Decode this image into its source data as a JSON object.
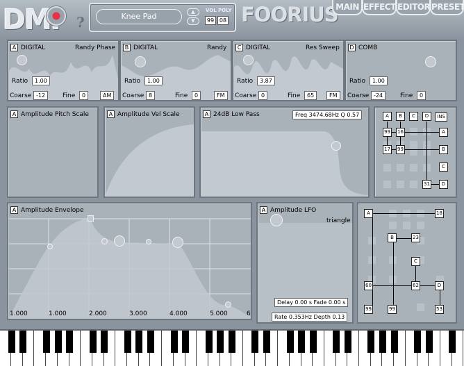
{
  "header": {
    "logo": "DMI",
    "help": "?",
    "brand": "FOORIUS",
    "patch_name": "Knee Pad",
    "vol_label": "VOL",
    "poly_label": "POLY",
    "vol": "99",
    "poly": "08",
    "arrow_up": "▲",
    "arrow_down": "▼",
    "tabs": [
      {
        "label": "MAIN"
      },
      {
        "label": "EFFECTS"
      },
      {
        "label": "EDITORS"
      },
      {
        "label": "PRESET"
      }
    ]
  },
  "osc": [
    {
      "letter": "A",
      "type": "DIGITAL",
      "wave": "Randy Phase",
      "ratio": "1.00",
      "coarse": "-12",
      "fine": "0",
      "mod": "AM"
    },
    {
      "letter": "B",
      "type": "DIGITAL",
      "wave": "Randy",
      "ratio": "1.00",
      "coarse": "8",
      "fine": "0",
      "mod": "FM"
    },
    {
      "letter": "C",
      "type": "DIGITAL",
      "wave": "Res Sweep",
      "ratio": "3.87",
      "coarse": "0",
      "fine": "65",
      "mod": "FM"
    },
    {
      "letter": "D",
      "type": "COMB",
      "wave": "",
      "ratio": "1.00",
      "coarse": "-24",
      "fine": "0",
      "mod": ""
    }
  ],
  "labels": {
    "ratio": "Ratio",
    "coarse": "Coarse",
    "fine": "Fine"
  },
  "mods": [
    {
      "letter": "A",
      "title": "Amplitude Pitch Scale"
    },
    {
      "letter": "A",
      "title": "Amplitude Vel Scale"
    },
    {
      "letter": "A",
      "title": "24dB Low Pass",
      "info": "Freq 3474.68Hz Q 0.57"
    }
  ],
  "matrix1": {
    "cols": [
      "A",
      "B",
      "C",
      "D"
    ],
    "ins": "INS",
    "rows": [
      "A",
      "B",
      "C",
      "D"
    ],
    "vals": {
      "r0c0": "99",
      "r0c1": "16",
      "r1c0": "17",
      "r1c1": "99",
      "r3c3": "31"
    }
  },
  "envelope": {
    "letter": "A",
    "title": "Amplitude Envelope",
    "ticks": [
      "1.000",
      "1.000",
      "2.000",
      "3.000",
      "4.000",
      "5.000",
      "6"
    ]
  },
  "lfo": {
    "letter": "A",
    "title": "Amplitude LFO",
    "wave": "triangle",
    "delay_fade": "Delay 0.00 s  Fade 0.00 s",
    "rate_depth": "Rate 0.353Hz Depth 0.13"
  },
  "matrix2": {
    "A": "A",
    "r0right": "18",
    "B": "B",
    "b_right": "23",
    "C": "C",
    "n60": "60",
    "n62": "62",
    "D": "D",
    "n99a": "99",
    "n99b": "99",
    "n53": "53"
  }
}
